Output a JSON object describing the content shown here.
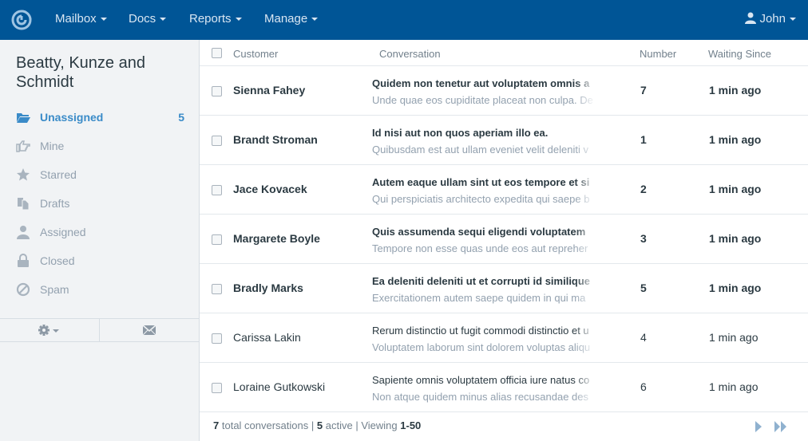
{
  "nav": {
    "items": [
      {
        "label": "Mailbox"
      },
      {
        "label": "Docs"
      },
      {
        "label": "Reports"
      },
      {
        "label": "Manage"
      }
    ],
    "user": "John"
  },
  "sidebar": {
    "mailbox_name": "Beatty, Kunze and Schmidt",
    "folders": [
      {
        "label": "Unassigned",
        "count": "5",
        "icon": "folder-open-icon"
      },
      {
        "label": "Mine",
        "count": "",
        "icon": "hand-pointing-icon"
      },
      {
        "label": "Starred",
        "count": "",
        "icon": "star-icon"
      },
      {
        "label": "Drafts",
        "count": "",
        "icon": "drafts-icon"
      },
      {
        "label": "Assigned",
        "count": "",
        "icon": "user-icon"
      },
      {
        "label": "Closed",
        "count": "",
        "icon": "lock-icon"
      },
      {
        "label": "Spam",
        "count": "",
        "icon": "ban-icon"
      }
    ]
  },
  "table": {
    "headers": {
      "customer": "Customer",
      "conversation": "Conversation",
      "number": "Number",
      "waiting": "Waiting Since"
    },
    "rows": [
      {
        "customer": "Sienna Fahey",
        "subject": "Quidem non tenetur aut voluptatem omnis a",
        "preview": "Unde quae eos cupiditate placeat non culpa. De",
        "number": "7",
        "waiting": "1 min ago",
        "unread": true
      },
      {
        "customer": "Brandt Stroman",
        "subject": "Id nisi aut non quos aperiam illo ea.",
        "preview": "Quibusdam est aut ullam eveniet velit deleniti v",
        "number": "1",
        "waiting": "1 min ago",
        "unread": true
      },
      {
        "customer": "Jace Kovacek",
        "subject": "Autem eaque ullam sint ut eos tempore et si",
        "preview": "Qui perspiciatis architecto expedita qui saepe b",
        "number": "2",
        "waiting": "1 min ago",
        "unread": true
      },
      {
        "customer": "Margarete Boyle",
        "subject": "Quis assumenda sequi eligendi voluptatem",
        "preview": "Tempore non esse quas unde eos aut repreher",
        "number": "3",
        "waiting": "1 min ago",
        "unread": true
      },
      {
        "customer": "Bradly Marks",
        "subject": "Ea deleniti deleniti ut et corrupti id similique",
        "preview": "Exercitationem autem saepe quidem in qui ma",
        "number": "5",
        "waiting": "1 min ago",
        "unread": true
      },
      {
        "customer": "Carissa Lakin",
        "subject": "Rerum distinctio ut fugit commodi distinctio et u",
        "preview": "Voluptatem laborum sint dolorem voluptas aliqu",
        "number": "4",
        "waiting": "1 min ago",
        "unread": false
      },
      {
        "customer": "Loraine Gutkowski",
        "subject": "Sapiente omnis voluptatem officia iure natus co",
        "preview": "Non atque quidem minus alias recusandae des",
        "number": "6",
        "waiting": "1 min ago",
        "unread": false
      }
    ]
  },
  "footer": {
    "total": "7",
    "total_label": "total conversations",
    "active": "5",
    "active_label": "active",
    "viewing_label": "Viewing",
    "range": "1-50"
  },
  "colors": {
    "nav_bg": "#005596",
    "accent": "#3a8bc8",
    "sidebar_bg": "#f1f3f5"
  }
}
